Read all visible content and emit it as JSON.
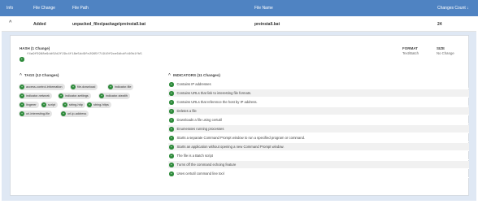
{
  "header": {
    "info": "Info",
    "file_change": "File Change",
    "file_path": "File Path",
    "file_name": "File Name",
    "changes_count": "Changes Count",
    "sort_indicator": "↓"
  },
  "row": {
    "expand_icon": "chevron-up",
    "change": "Added",
    "path": "unpacked_files\\package\\preinstall.bat",
    "name": "preinstall.bat",
    "count": "24"
  },
  "hash": {
    "title": "HASH (1 Change)",
    "value": "f4a9f5988e9dd02d2f29c4f18e5dd9fe2965f71910f9ce6dbdfd40b1fb5"
  },
  "format": {
    "label": "FORMAT",
    "value": "Text/Batch"
  },
  "size": {
    "label": "SIZE",
    "value": "No Change"
  },
  "tags": {
    "title": "TAGS (12 Changes)",
    "items": [
      "access-control-information",
      "file-download",
      "indicator-file",
      "indicator-network",
      "indicator-settings",
      "indicator-stealth",
      "lingerer",
      "script",
      "string-http",
      "string-https",
      "url-interesting-file",
      "url-ip-address"
    ]
  },
  "indicators": {
    "title": "INDICATORS (11 Changes)",
    "items": [
      "Contains IP addresses",
      "Contains URLs that link to interesting file formats.",
      "Contains URLs that reference the host by IP address.",
      "Deletes a file",
      "Downloads a file using certutil",
      "Enumerates running processes",
      "Starts a separate Command Prompt window to run a specified program or command.",
      "Starts an application without opening a new Command Prompt window.",
      "The file is a Batch script",
      "Turns off the command echoing feature",
      "Uses certutil command line tool"
    ]
  },
  "colors": {
    "header_bg": "#4f83c2",
    "panel_bg": "#dfe8f4",
    "badge_green": "#2d8a3a",
    "tag_bg": "#e4e4e4"
  }
}
